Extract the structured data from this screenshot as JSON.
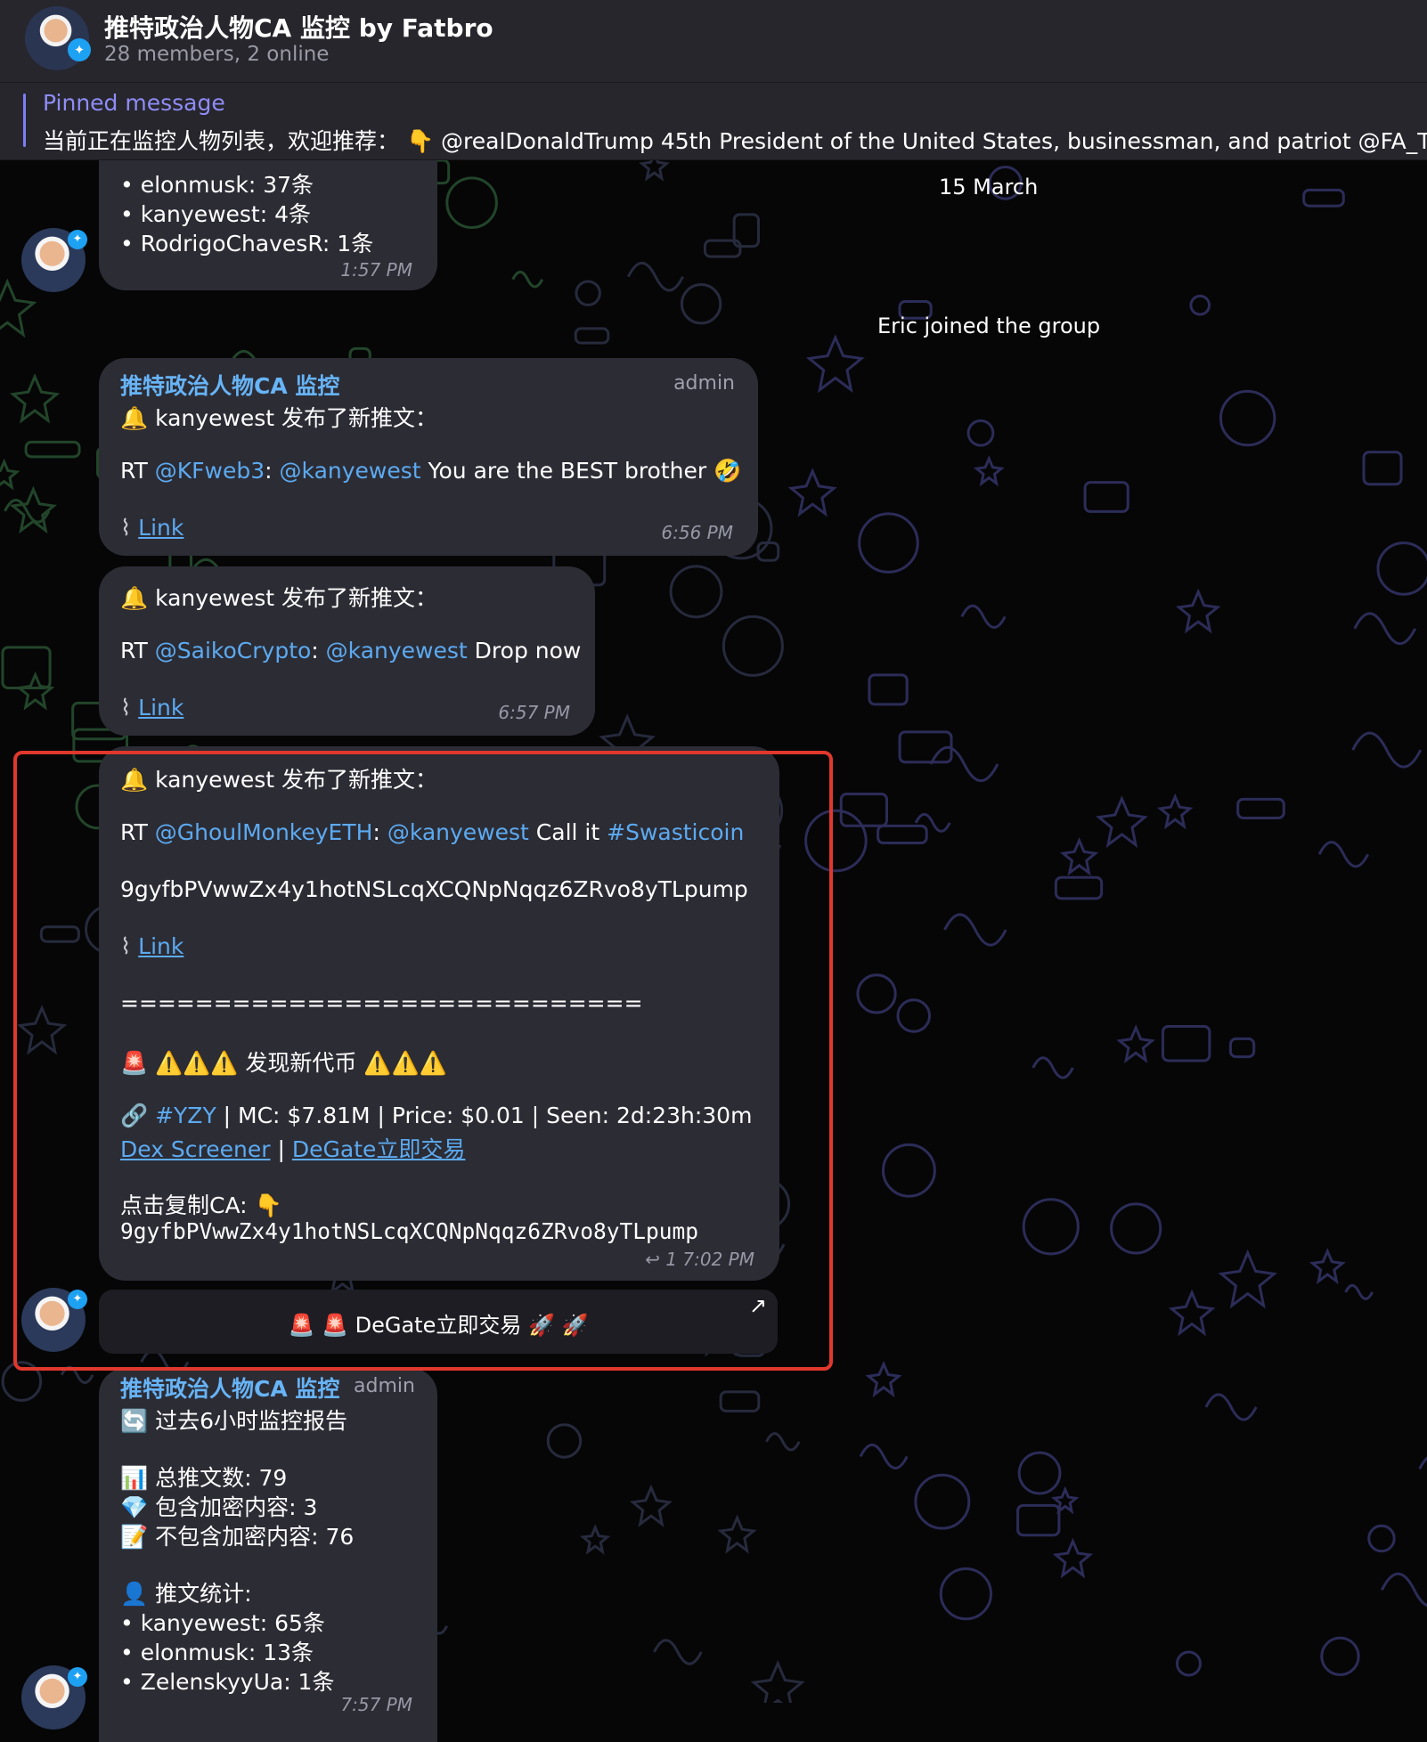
{
  "header": {
    "title": "推特政治人物CA 监控 by Fatbro",
    "subtitle": "28 members, 2 online"
  },
  "pinned": {
    "label": "Pinned message",
    "text": "当前正在监控人物列表，欢迎推荐： 👇 @realDonaldTrump 45th President of the United States, businessman, and patriot @FA_T"
  },
  "date_separator": "15 March",
  "service_message": "Eric joined the group",
  "messages": [
    {
      "partial_lines": [
        "• elonmusk: 37条",
        "• kanyewest: 4条",
        "• RodrigoChavesR: 1条"
      ],
      "time": "1:57 PM"
    },
    {
      "sender": "推特政治人物CA 监控",
      "role": "admin",
      "header": "🔔 kanyewest 发布了新推文：",
      "body": {
        "prefix": "RT ",
        "mention1": "@KFweb3",
        "sep": ": ",
        "mention2": "@kanyewest",
        "text": " You are the BEST brother 🤣"
      },
      "link_label": "Link",
      "time": "6:56 PM"
    },
    {
      "header": "🔔 kanyewest 发布了新推文：",
      "body": {
        "prefix": "RT ",
        "mention1": "@SaikoCrypto",
        "sep": ": ",
        "mention2": "@kanyewest",
        "text": " Drop now"
      },
      "link_label": "Link",
      "time": "6:57 PM"
    },
    {
      "header": "🔔 kanyewest 发布了新推文：",
      "body": {
        "prefix": "RT ",
        "mention1": "@GhoulMonkeyETH",
        "sep": ": ",
        "mention2": "@kanyewest",
        "text": " Call it ",
        "hashtag": "#Swasticoin"
      },
      "ca_line": "9gyfbPVwwZx4y1hotNSLcqXCQNpNqqz6ZRvo8yTLpump",
      "link_label": "Link",
      "divider": "============================",
      "alert": "🚨 ⚠️⚠️⚠️ 发现新代币 ⚠️⚠️⚠️",
      "token_hashtag": "#YZY",
      "token_stats": " | MC: $7.81M | Price: $0.01 | Seen: 2d:23h:30m",
      "dex_link": "Dex Screener",
      "link_sep": " | ",
      "degate_link": "DeGate立即交易",
      "copy_label": "点击复制CA: 👇",
      "ca_mono": "9gyfbPVwwZx4y1hotNSLcqXCQNpNqqz6ZRvo8yTLpump",
      "reply_count": "↩ 1",
      "time": "7:02 PM",
      "inline_button": "🚨 🚨 DeGate立即交易 🚀 🚀",
      "inline_button_arrow": "↗"
    },
    {
      "sender": "推特政治人物CA 监控",
      "role": "admin",
      "title": "🔄 过去6小时监控报告",
      "stats": [
        "📊 总推文数: 79",
        "💎 包含加密内容: 3",
        "📝 不包含加密内容: 76"
      ],
      "section": "👤 推文统计:",
      "list": [
        "• kanyewest: 65条",
        "• elonmusk: 13条",
        "• ZelenskyyUa: 1条"
      ],
      "time": "7:57 PM"
    }
  ]
}
